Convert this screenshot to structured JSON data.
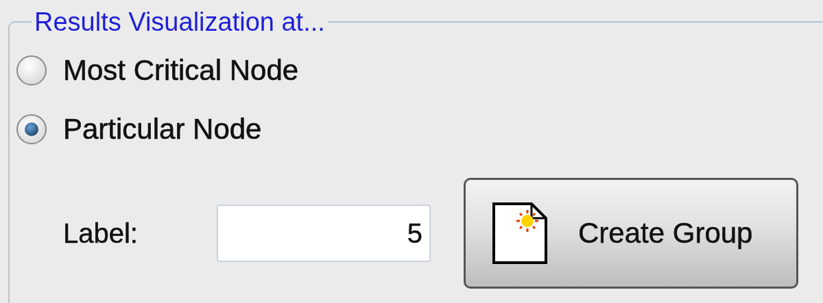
{
  "group": {
    "title": "Results Visualization at...",
    "options": [
      {
        "label": "Most Critical Node",
        "selected": false
      },
      {
        "label": "Particular Node",
        "selected": true
      }
    ],
    "field": {
      "label": "Label:",
      "value": "5"
    },
    "button": {
      "label": "Create Group"
    }
  }
}
